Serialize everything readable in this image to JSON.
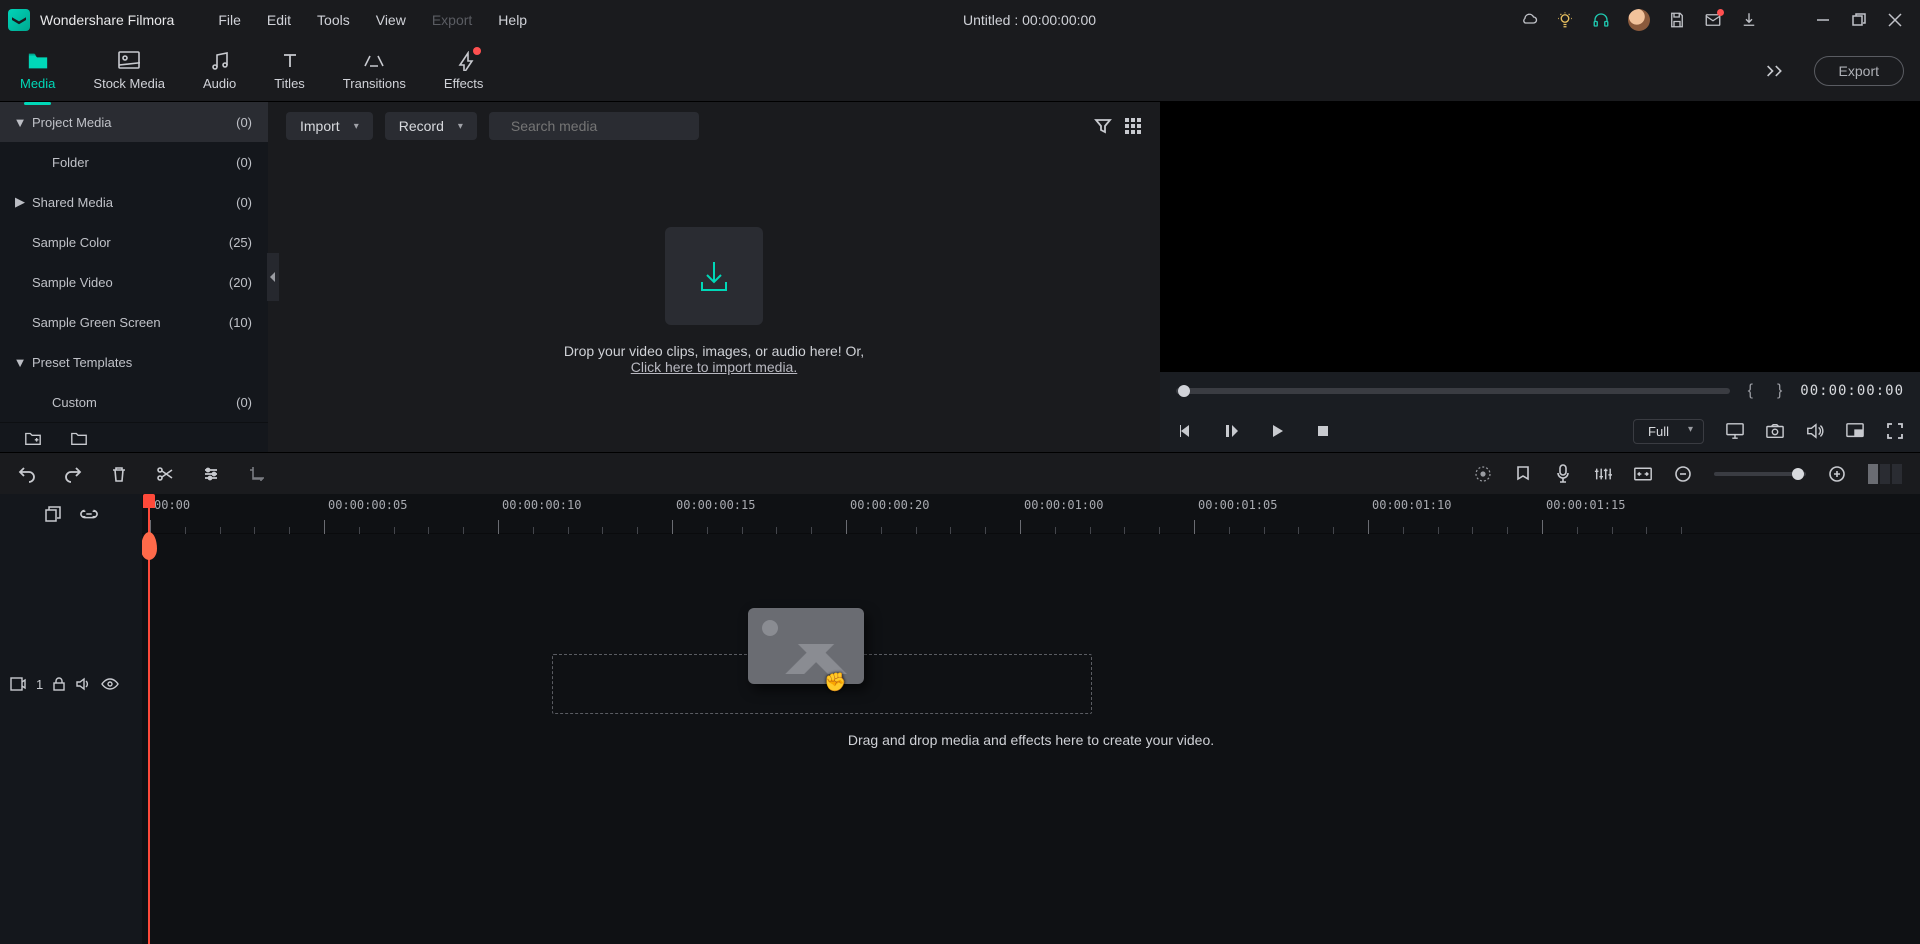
{
  "titlebar": {
    "app_name": "Wondershare Filmora",
    "menus": [
      "File",
      "Edit",
      "Tools",
      "View",
      "Export",
      "Help"
    ],
    "disabled_menu_index": 4,
    "project_title": "Untitled : 00:00:00:00"
  },
  "navtabs": {
    "items": [
      "Media",
      "Stock Media",
      "Audio",
      "Titles",
      "Transitions",
      "Effects"
    ],
    "active_index": 0,
    "export_label": "Export"
  },
  "sidebar": {
    "items": [
      {
        "label": "Project Media",
        "count": "(0)",
        "chev": "▼",
        "indent": false,
        "selected": true
      },
      {
        "label": "Folder",
        "count": "(0)",
        "chev": "",
        "indent": true,
        "selected": false
      },
      {
        "label": "Shared Media",
        "count": "(0)",
        "chev": "▶",
        "indent": false,
        "selected": false
      },
      {
        "label": "Sample Color",
        "count": "(25)",
        "chev": "",
        "indent": false,
        "selected": false
      },
      {
        "label": "Sample Video",
        "count": "(20)",
        "chev": "",
        "indent": false,
        "selected": false
      },
      {
        "label": "Sample Green Screen",
        "count": "(10)",
        "chev": "",
        "indent": false,
        "selected": false
      },
      {
        "label": "Preset Templates",
        "count": "",
        "chev": "▼",
        "indent": false,
        "selected": false
      },
      {
        "label": "Custom",
        "count": "(0)",
        "chev": "",
        "indent": true,
        "selected": false
      }
    ]
  },
  "media_panel": {
    "import_label": "Import",
    "record_label": "Record",
    "search_placeholder": "Search media",
    "drop_text": "Drop your video clips, images, or audio here! Or,",
    "drop_link": "Click here to import media."
  },
  "preview": {
    "timecode": "00:00:00:00",
    "quality": "Full"
  },
  "timeline": {
    "time_labels": [
      "00:00",
      "00:00:00:05",
      "00:00:00:10",
      "00:00:00:15",
      "00:00:00:20",
      "00:00:01:00",
      "00:00:01:05",
      "00:00:01:10",
      "00:00:01:15"
    ],
    "drop_hint": "Drag and drop media and effects here to create your video.",
    "track_index": "1"
  }
}
